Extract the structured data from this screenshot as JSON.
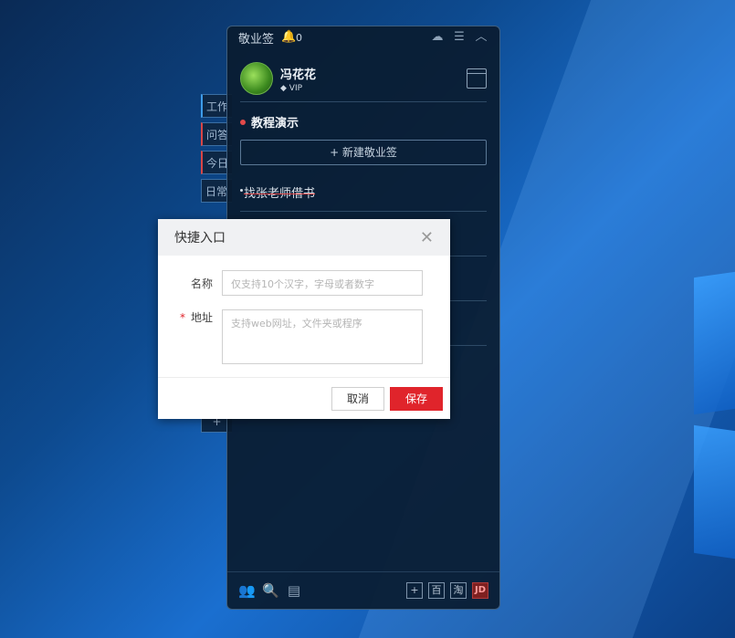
{
  "app": {
    "title": "敬业签",
    "notification_count": "0",
    "user": {
      "name": "冯花花",
      "badge": "VIP"
    },
    "group_title": "教程演示",
    "new_note_label": "+ 新建敬业签",
    "tasks": [
      {
        "text": "找张老师借书",
        "done": true
      }
    ],
    "side_tabs": [
      "工作",
      "问答",
      "今日",
      "日常"
    ],
    "bottom_right": [
      "+",
      "百",
      "淘",
      "JD"
    ]
  },
  "dialog": {
    "title": "快捷入口",
    "name_label": "名称",
    "name_placeholder": "仅支持10个汉字，字母或者数字",
    "address_label": "地址",
    "address_required": "*",
    "address_placeholder": "支持web网址，文件夹或程序",
    "cancel_label": "取消",
    "save_label": "保存"
  },
  "colors": {
    "accent": "#e0242b",
    "panel_bg": "#0a1c30",
    "desktop_bg": "#0d4a8f"
  }
}
